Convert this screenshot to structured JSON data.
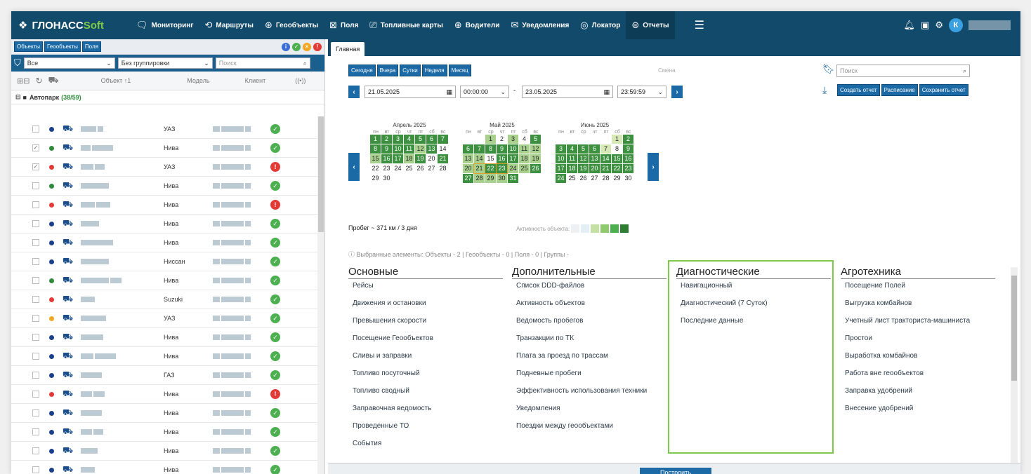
{
  "topbar": {
    "logo_main": "ГЛОНАСС",
    "logo_soft": "Soft",
    "nav": [
      {
        "label": "Мониторинг",
        "icon": "chat-icon"
      },
      {
        "label": "Маршруты",
        "icon": "route-icon"
      },
      {
        "label": "Геообъекты",
        "icon": "compass-icon"
      },
      {
        "label": "Поля",
        "icon": "field-icon"
      },
      {
        "label": "Топливные карты",
        "icon": "card-icon"
      },
      {
        "label": "Водители",
        "icon": "wheel-icon"
      },
      {
        "label": "Уведомления",
        "icon": "envelope-icon"
      },
      {
        "label": "Локатор",
        "icon": "locator-icon"
      },
      {
        "label": "Отчеты",
        "icon": "report-icon"
      }
    ],
    "avatar": "К"
  },
  "left": {
    "tabs": [
      "Объекты",
      "Геообъекты",
      "Поля"
    ],
    "filter": "Все",
    "grouping": "Без группировки",
    "search_placeholder": "Поиск",
    "columns": {
      "object": "Объект ↑1",
      "model": "Модель",
      "client": "Клиент"
    },
    "group": {
      "name": "Автопарк",
      "count": "(38/59)"
    },
    "rows": [
      {
        "model": "УАЗ",
        "dot": "#1a3f8c",
        "checked": false,
        "status": "ok"
      },
      {
        "model": "Нива",
        "dot": "#2e8b3a",
        "checked": true,
        "status": "ok"
      },
      {
        "model": "УАЗ",
        "dot": "#e53935",
        "checked": true,
        "status": "err"
      },
      {
        "model": "Нива",
        "dot": "#2e8b3a",
        "checked": false,
        "status": "ok"
      },
      {
        "model": "Нива",
        "dot": "#e53935",
        "checked": false,
        "status": "err"
      },
      {
        "model": "Нива",
        "dot": "#1a3f8c",
        "checked": false,
        "status": "ok"
      },
      {
        "model": "Нива",
        "dot": "#1a3f8c",
        "checked": false,
        "status": "ok"
      },
      {
        "model": "Ниссан",
        "dot": "#1a3f8c",
        "checked": false,
        "status": "ok"
      },
      {
        "model": "Нива",
        "dot": "#2e8b3a",
        "checked": false,
        "status": "ok"
      },
      {
        "model": "Suzuki",
        "dot": "#e53935",
        "checked": false,
        "status": "ok"
      },
      {
        "model": "УАЗ",
        "dot": "#f5a623",
        "checked": false,
        "status": "ok"
      },
      {
        "model": "Нива",
        "dot": "#1a3f8c",
        "checked": false,
        "status": "ok"
      },
      {
        "model": "Нива",
        "dot": "#1a3f8c",
        "checked": false,
        "status": "ok"
      },
      {
        "model": "ГАЗ",
        "dot": "#1a3f8c",
        "checked": false,
        "status": "ok"
      },
      {
        "model": "Нива",
        "dot": "#e53935",
        "checked": false,
        "status": "err"
      },
      {
        "model": "Нива",
        "dot": "#1a3f8c",
        "checked": false,
        "status": "ok"
      },
      {
        "model": "Нива",
        "dot": "#1a3f8c",
        "checked": false,
        "status": "ok"
      },
      {
        "model": "Нива",
        "dot": "#1a3f8c",
        "checked": false,
        "status": "ok"
      },
      {
        "model": "Нива",
        "dot": "#1a3f8c",
        "checked": false,
        "status": "ok"
      }
    ]
  },
  "right": {
    "tab": "Главная",
    "periods": [
      "Сегодня",
      "Вчера",
      "Сутки",
      "Неделя",
      "Месяц"
    ],
    "shift": "Смена",
    "search_placeholder": "Поиск",
    "date_from": "21.05.2025",
    "time_from": "00:00:00",
    "date_to": "23.05.2025",
    "time_to": "23:59:59",
    "dash": "-",
    "actions": [
      "Создать отчет",
      "Расписание",
      "Сохранить отчет"
    ],
    "calendars": [
      {
        "title": "Апрель 2025",
        "start": 1,
        "days": 30
      },
      {
        "title": "Май 2025",
        "start": 3,
        "days": 31
      },
      {
        "title": "Июнь 2025",
        "start": 6,
        "days": 30
      }
    ],
    "dow": [
      "пн",
      "вт",
      "ср",
      "чт",
      "пт",
      "сб",
      "вс"
    ],
    "mileage": "Пробег ~ 371 км / 3 дня",
    "activity_label": "Активность объекта:",
    "selected": "Выбранные элементы:  Объекты - 2  |  Геообъекты - 0  |  Поля - 0  |  Группы -",
    "columns": [
      {
        "title": "Основные",
        "items": [
          "Рейсы",
          "Движения и остановки",
          "Превышения скорости",
          "Посещение Геообъектов",
          "Сливы и заправки",
          "Топливо посуточный",
          "Топливо сводный",
          "Заправочная ведомость",
          "Проведенные ТО",
          "События"
        ]
      },
      {
        "title": "Дополнительные",
        "items": [
          "Список DDD-файлов",
          "Активность объектов",
          "Ведомость пробегов",
          "Транзакции по ТК",
          "Плата за проезд по трассам",
          "Подневные пробеги",
          "Эффективность использования техники",
          "Уведомления",
          "Поездки между геообъектами"
        ]
      },
      {
        "title": "Диагностические",
        "items": [
          "Навигационный",
          "Диагностический (7 Суток)",
          "Последние данные"
        ]
      },
      {
        "title": "Агротехника",
        "items": [
          "Посещение Полей",
          "Выгрузка комбайнов",
          "Учетный лист тракториста-машиниста",
          "Простои",
          "Выработка комбайнов",
          "Работа вне геообъектов",
          "Заправка удобрений",
          "Внесение удобрений"
        ]
      }
    ],
    "build": "Построить"
  },
  "colors": {
    "header": "#114a6a",
    "button": "#1b6aa5",
    "highlight": "#7ec84a",
    "ok": "#4caf50",
    "err": "#e53935"
  }
}
